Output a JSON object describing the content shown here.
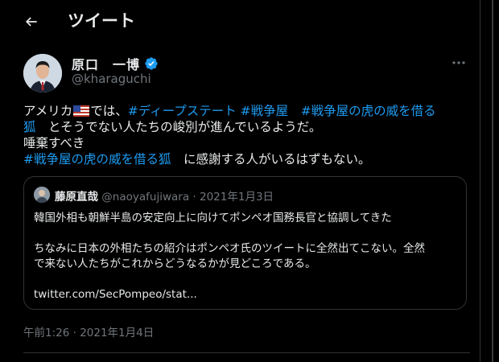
{
  "header": {
    "title": "ツイート"
  },
  "author": {
    "display_name": "原口　一博",
    "handle": "@kharaguchi"
  },
  "tweet": {
    "line1": {
      "t1": "アメリカ",
      "t2": "では、",
      "h1": "#ディープステート",
      "h2": "#戦争屋",
      "h3": "#戦争屋の虎の威を借る"
    },
    "line2": {
      "h1": "狐",
      "t1": "とそうでない人たちの峻別が進んでいるようだ。"
    },
    "line3": {
      "t1": "唾棄すべき"
    },
    "line4": {
      "h1": "#戦争屋の虎の威を借る狐",
      "t1": "に感謝する人がいるはずもない。"
    }
  },
  "quote": {
    "name": "藤原直哉",
    "handle": "@naoyafujiwara",
    "separator": "·",
    "date": "2021年1月3日",
    "body_line1": "韓国外相も朝鮮半島の安定向上に向けてポンペオ国務長官と協調してきた",
    "body_line2": "ちなみに日本の外相たちの紹介はポンペオ氏のツイートに全然出てこない。全然",
    "body_line3": "で来ない人たちがこれからどうなるかが見どころである。",
    "link": "twitter.com/SecPompeo/stat..."
  },
  "timestamp": "午前1:26 · 2021年1月4日",
  "colors": {
    "background": "#000000",
    "text": "#e7e9ea",
    "muted": "#71767b",
    "accent": "#1d9bf0",
    "border": "#2f3336"
  },
  "icons": [
    "back-arrow-icon",
    "verified-badge-icon",
    "more-options-icon",
    "us-flag-icon"
  ]
}
